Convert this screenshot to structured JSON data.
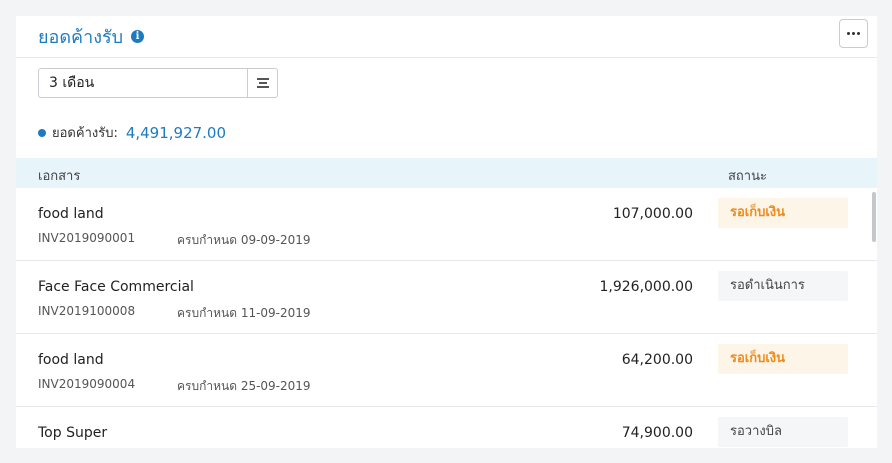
{
  "header": {
    "title": "ยอดค้างรับ",
    "info_icon": "i"
  },
  "filter": {
    "period_value": "3 เดือน"
  },
  "summary": {
    "label": "ยอดค้างรับ:",
    "amount": "4,491,927.00"
  },
  "table": {
    "columns": {
      "document": "เอกสาร",
      "status": "สถานะ"
    },
    "rows": [
      {
        "customer": "food land",
        "invoice": "INV2019090001",
        "due": "ครบกำหนด 09-09-2019",
        "amount": "107,000.00",
        "status": "รอเก็บเงิน",
        "status_type": "pending"
      },
      {
        "customer": "Face Face Commercial",
        "invoice": "INV2019100008",
        "due": "ครบกำหนด 11-09-2019",
        "amount": "1,926,000.00",
        "status": "รอดำเนินการ",
        "status_type": "neutral"
      },
      {
        "customer": "food land",
        "invoice": "INV2019090004",
        "due": "ครบกำหนด 25-09-2019",
        "amount": "64,200.00",
        "status": "รอเก็บเงิน",
        "status_type": "pending"
      },
      {
        "customer": "Top Super",
        "invoice": "",
        "due": "",
        "amount": "74,900.00",
        "status": "รอวางบิล",
        "status_type": "neutral"
      }
    ]
  },
  "colors": {
    "accent": "#1e7bbf",
    "pending": "#f08a1a",
    "header_bg": "#e7f4fa"
  },
  "icons": {
    "info": "info-icon",
    "more": "more-icon",
    "menu": "menu-icon"
  }
}
